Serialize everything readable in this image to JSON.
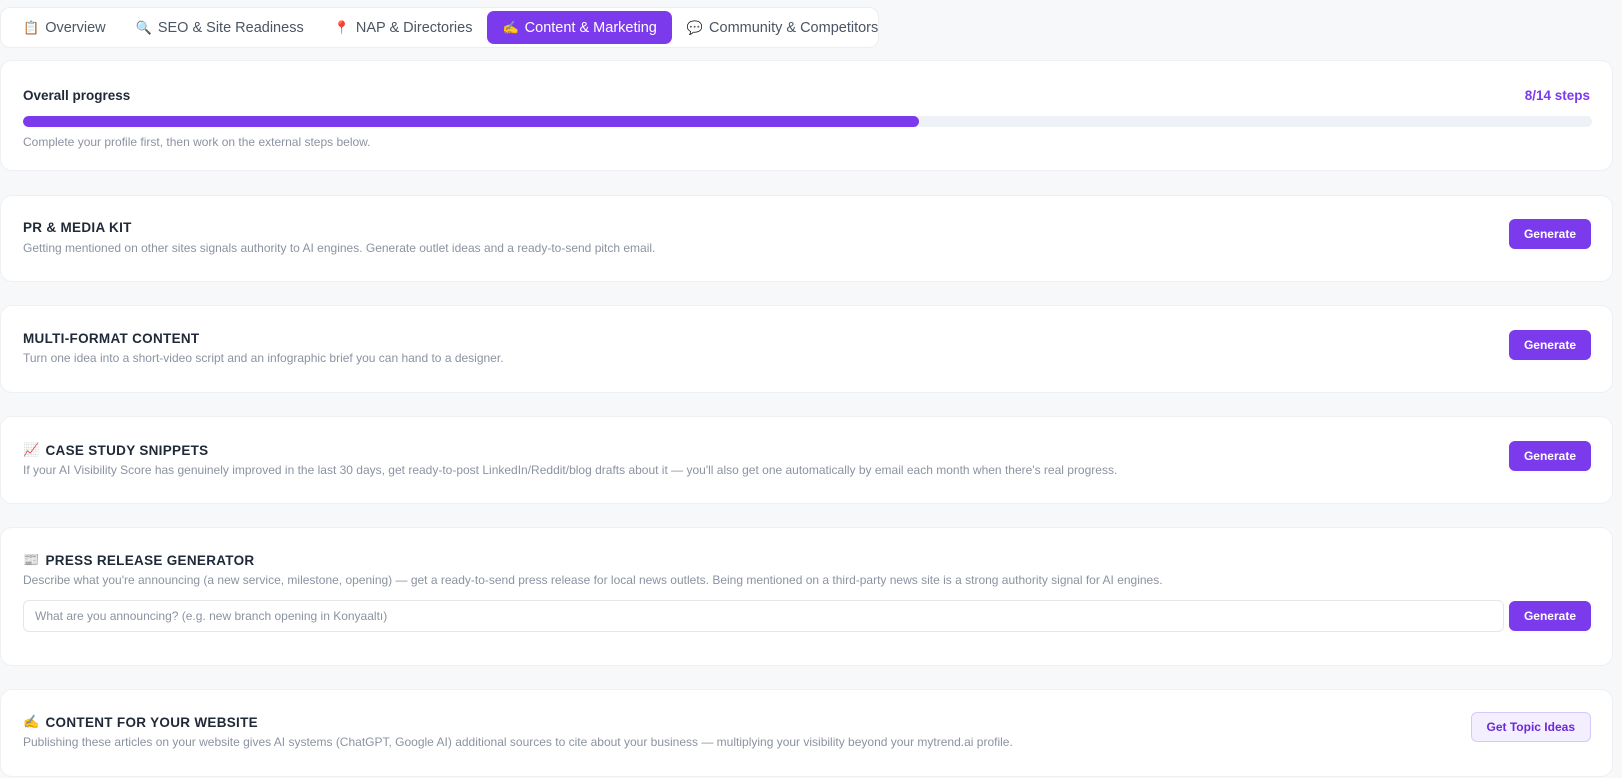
{
  "tabs": [
    {
      "icon": "📋",
      "label": "Overview",
      "active": false
    },
    {
      "icon": "🔍",
      "label": "SEO & Site Readiness",
      "active": false
    },
    {
      "icon": "📍",
      "label": "NAP & Directories",
      "active": false
    },
    {
      "icon": "✍️",
      "label": "Content & Marketing",
      "active": true
    },
    {
      "icon": "💬",
      "label": "Community & Competitors",
      "active": false
    }
  ],
  "progress": {
    "label": "Overall progress",
    "count_text": "8/14 steps",
    "completed": 8,
    "total": 14,
    "fraction": 0.571,
    "hint": "Complete your profile first, then work on the external steps below."
  },
  "sections": {
    "pr": {
      "title": "PR & MEDIA KIT",
      "description": "Getting mentioned on other sites signals authority to AI engines. Generate outlet ideas and a ready-to-send pitch email.",
      "button": "Generate"
    },
    "multiformat": {
      "title": "MULTI-FORMAT CONTENT",
      "description": "Turn one idea into a short-video script and an infographic brief you can hand to a designer.",
      "button": "Generate"
    },
    "casestudy": {
      "icon": "📈",
      "title": "CASE STUDY SNIPPETS",
      "description": "If your AI Visibility Score has genuinely improved in the last 30 days, get ready-to-post LinkedIn/Reddit/blog drafts about it — you'll also get one automatically by email each month when there's real progress.",
      "button": "Generate"
    },
    "press": {
      "icon": "📰",
      "title": "PRESS RELEASE GENERATOR",
      "description": "Describe what you're announcing (a new service, milestone, opening) — get a ready-to-send press release for local news outlets. Being mentioned on a third-party news site is a strong authority signal for AI engines.",
      "input_value": "",
      "input_placeholder": "What are you announcing? (e.g. new branch opening in Konyaaltı)",
      "button": "Generate"
    },
    "website": {
      "icon": "✍️",
      "title": "CONTENT FOR YOUR WEBSITE",
      "description": "Publishing these articles on your website gives AI systems (ChatGPT, Google AI) additional sources to cite about your business — multiplying your visibility beyond your mytrend.ai profile.",
      "button": "Get Topic Ideas"
    }
  },
  "colors": {
    "accent": "#7c3aed",
    "background": "#f7f8fa",
    "muted_text": "#8b93a1"
  }
}
